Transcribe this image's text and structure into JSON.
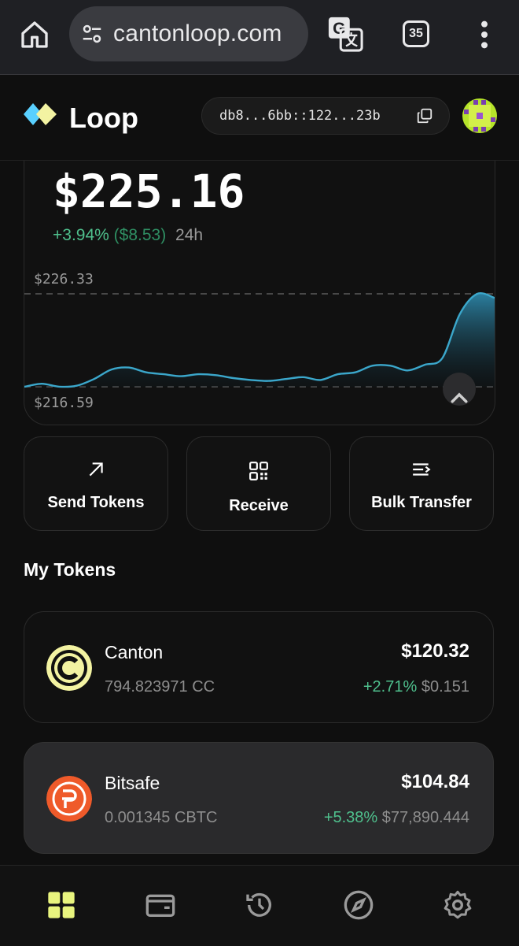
{
  "browser": {
    "url": "cantonloop.com",
    "tab_count": "35"
  },
  "app": {
    "brand": "Loop",
    "address": "db8...6bb::122...23b"
  },
  "portfolio": {
    "balance": "$225.16",
    "change_pct": "+3.94%",
    "change_abs": "($8.53)",
    "period": "24h",
    "high_label": "$226.33",
    "low_label": "$216.59"
  },
  "chart_data": {
    "type": "area",
    "ylim": [
      216.59,
      226.33
    ],
    "values": [
      216.59,
      216.9,
      216.6,
      216.7,
      217.4,
      218.4,
      218.6,
      218.1,
      217.9,
      217.7,
      217.9,
      217.8,
      217.5,
      217.3,
      217.2,
      217.4,
      217.6,
      217.3,
      217.9,
      218.1,
      218.8,
      218.8,
      218.3,
      218.9,
      219.6,
      224.2,
      226.33,
      225.9
    ]
  },
  "actions": {
    "send": "Send Tokens",
    "receive": "Receive",
    "bulk": "Bulk Transfer"
  },
  "tokens_section": {
    "title": "My Tokens",
    "items": [
      {
        "name": "Canton",
        "amount": "794.823971 CC",
        "value": "$120.32",
        "change": "+2.71%",
        "price": "$0.151"
      },
      {
        "name": "Bitsafe",
        "amount": "0.001345 CBTC",
        "value": "$104.84",
        "change": "+5.38%",
        "price": "$77,890.444"
      }
    ]
  },
  "colors": {
    "accent_green": "#4fc08d",
    "chart_line": "#3ba7cb",
    "canton_logo": "#f3f3a2",
    "bitsafe_logo": "#ef5a2a"
  },
  "icons": {
    "home": "home-icon",
    "site_settings": "tune-icon",
    "translate": "translate-icon",
    "menu": "more-vert-icon",
    "copy": "copy-icon",
    "send": "arrow-up-right-icon",
    "receive": "qr-code-icon",
    "bulk": "list-transfer-icon",
    "nav": [
      "grid-icon",
      "wallet-icon",
      "history-icon",
      "compass-icon",
      "gear-icon"
    ]
  }
}
